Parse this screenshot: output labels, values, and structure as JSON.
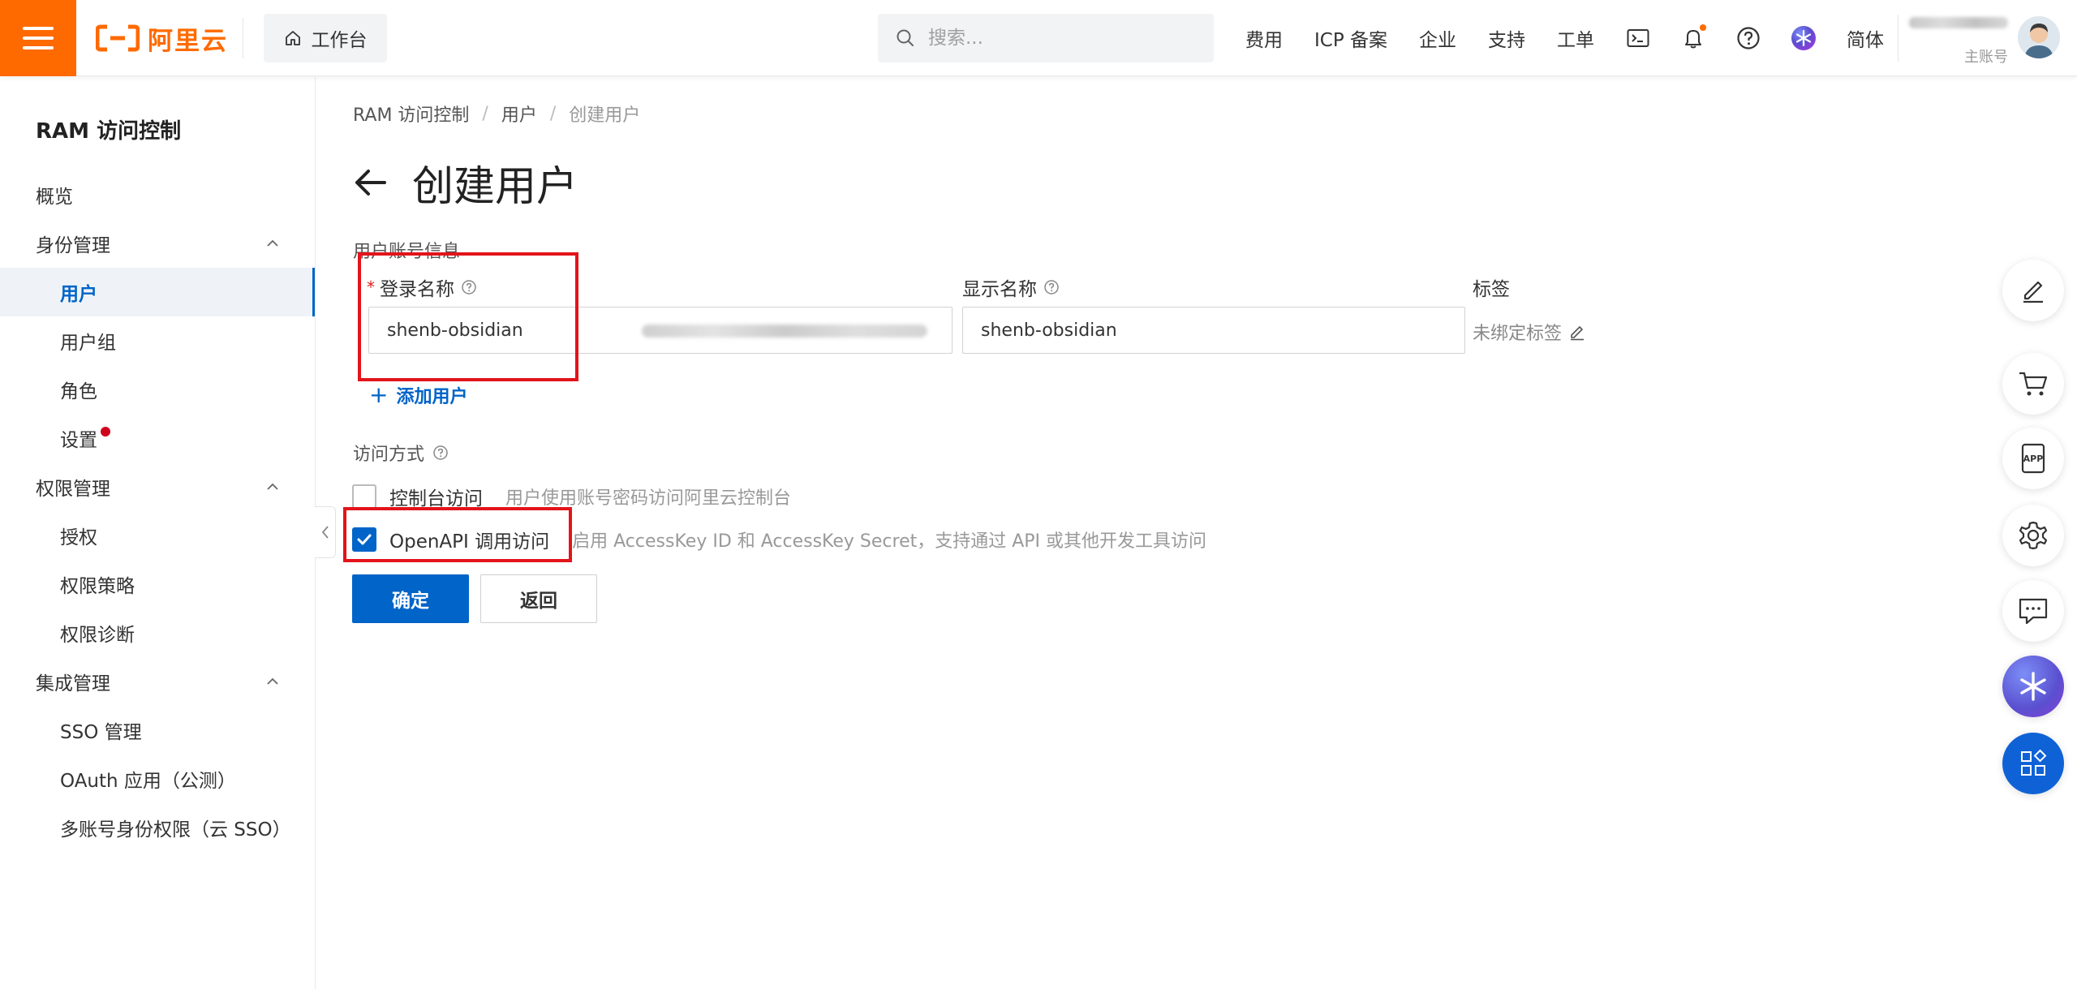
{
  "header": {
    "brand_text": "阿里云",
    "workbench_label": "工作台",
    "search_placeholder": "搜索...",
    "nav_items": [
      "费用",
      "ICP 备案",
      "企业",
      "支持",
      "工单"
    ],
    "language": "简体",
    "account_role": "主账号",
    "accent_color": "#ff6a00"
  },
  "sidebar": {
    "title": "RAM 访问控制",
    "items": [
      {
        "label": "概览",
        "level": 0
      },
      {
        "label": "身份管理",
        "level": 0,
        "expanded": true
      },
      {
        "label": "用户",
        "level": 1,
        "active": true
      },
      {
        "label": "用户组",
        "level": 1
      },
      {
        "label": "角色",
        "level": 1
      },
      {
        "label": "设置",
        "level": 1,
        "badge_dot": true
      },
      {
        "label": "权限管理",
        "level": 0,
        "expanded": true
      },
      {
        "label": "授权",
        "level": 1
      },
      {
        "label": "权限策略",
        "level": 1
      },
      {
        "label": "权限诊断",
        "level": 1
      },
      {
        "label": "集成管理",
        "level": 0,
        "expanded": true
      },
      {
        "label": "SSO 管理",
        "level": 1
      },
      {
        "label": "OAuth 应用（公测）",
        "level": 1
      },
      {
        "label": "多账号身份权限（云 SSO）",
        "level": 1
      }
    ]
  },
  "breadcrumb": [
    "RAM 访问控制",
    "用户",
    "创建用户"
  ],
  "page_title": "创建用户",
  "form": {
    "section_title": "用户账号信息",
    "login_name_label": "登录名称",
    "login_name_value": "shenb-obsidian",
    "display_name_label": "显示名称",
    "display_name_value": "shenb-obsidian",
    "tags_label": "标签",
    "tags_value": "未绑定标签",
    "add_user_label": "添加用户",
    "access_label": "访问方式",
    "console_access_label": "控制台访问",
    "console_access_desc": "用户使用账号密码访问阿里云控制台",
    "console_access_checked": false,
    "openapi_access_label": "OpenAPI 调用访问",
    "openapi_access_desc": "启用 AccessKey ID 和 AccessKey Secret，支持通过 API 或其他开发工具访问",
    "openapi_access_checked": true,
    "confirm_label": "确定",
    "back_label": "返回"
  },
  "colors": {
    "primary": "#0064c8",
    "annotation": "#e3141b"
  }
}
